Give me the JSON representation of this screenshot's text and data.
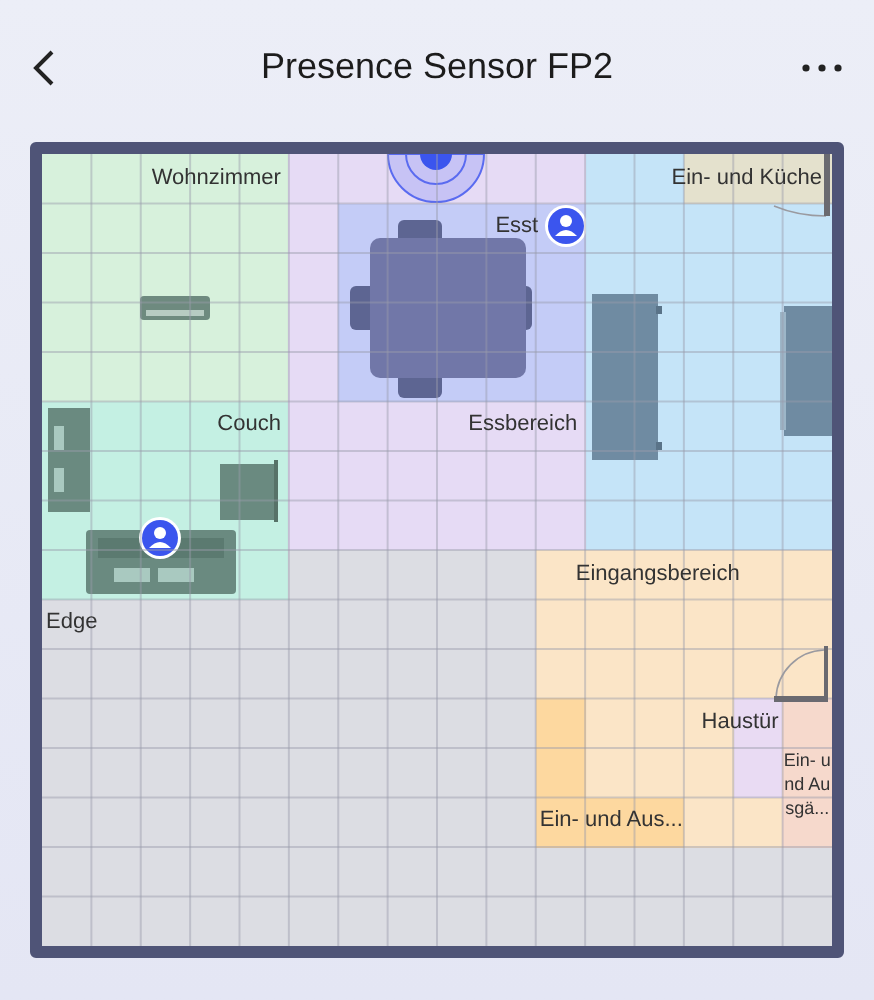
{
  "header": {
    "title": "Presence Sensor FP2"
  },
  "map": {
    "zones": [
      {
        "label": "Wohnzimmer",
        "color": "#d7f1dc"
      },
      {
        "label": "Couch",
        "color": "#c4f0e3"
      },
      {
        "label": "Essbereich",
        "color": "#e6dbf5"
      },
      {
        "label": "Esst",
        "color": "#c4ccf7"
      },
      {
        "color": "#c5e4f8"
      },
      {
        "label": "Ein- und Küche",
        "color": "#e4e1cd"
      },
      {
        "label": "Eingangsbereich",
        "color": "#fbe5c7"
      },
      {
        "label": "Ein- und Aus...",
        "color": "#fdd89f"
      },
      {
        "label": "Haustür",
        "color": "#e9dbf3"
      },
      {
        "label": "Ein- und Ausgä...",
        "color": "#f6d9cc"
      },
      {
        "label": "Edge",
        "color": "#dcdde3"
      }
    ]
  }
}
